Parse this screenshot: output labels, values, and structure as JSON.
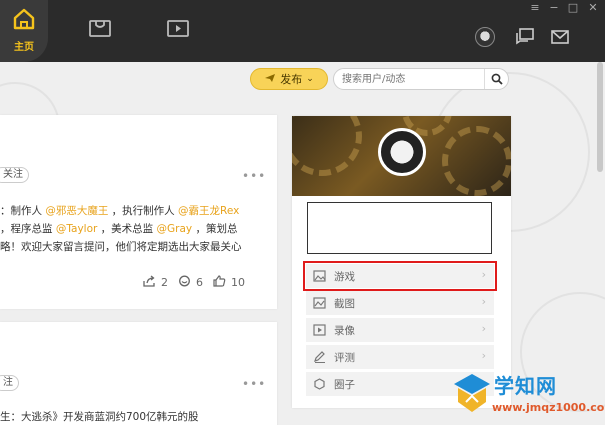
{
  "topbar": {
    "home_label": "主页",
    "home_color": "#f5c31c",
    "window_controls": [
      "menu-icon",
      "minimize-icon",
      "maximize-icon",
      "close-icon"
    ]
  },
  "toolbar": {
    "publish_label": "发布",
    "search_placeholder": "搜索用户/动态"
  },
  "feed": {
    "card1": {
      "follow_label": "关注",
      "line1_prefix": "：制作人 ",
      "line1_m1": "@邪恶大魔王",
      "line1_mid": " ，执行制作人 ",
      "line1_m2": "@霸王龙Rex",
      "line2_prefix": "，程序总监 ",
      "line2_m1": "@Taylor",
      "line2_mid": " ，美术总监 ",
      "line2_m2": "@Gray",
      "line2_suffix": " ，策划总",
      "line3": "略！欢迎大家留言提问，他们将定期选出大家最关心",
      "shares": "2",
      "comments": "6",
      "likes": "10"
    },
    "card2": {
      "follow_label": "注",
      "line1": "生：大逃杀》开发商蓝洞约700亿韩元的股"
    }
  },
  "side": {
    "menu": [
      {
        "label": "游戏",
        "icon": "image-icon"
      },
      {
        "label": "截图",
        "icon": "screenshot-icon"
      },
      {
        "label": "录像",
        "icon": "video-icon"
      },
      {
        "label": "评测",
        "icon": "pen-icon"
      },
      {
        "label": "圈子",
        "icon": "circle-icon"
      }
    ],
    "highlight_color": "#e01b1b"
  },
  "watermark": {
    "title": "学知网",
    "url": "www.jmqz1000.com"
  }
}
